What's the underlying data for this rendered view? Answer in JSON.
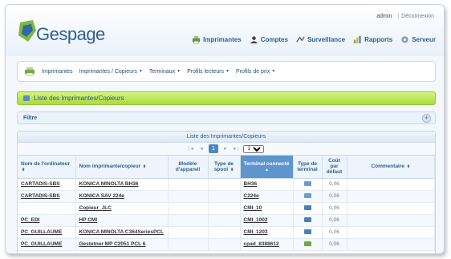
{
  "user": {
    "name": "admin",
    "logout": "Déconnexion"
  },
  "logo": {
    "text": "Gespage"
  },
  "topnav": [
    {
      "label": "Imprimantes",
      "icon": "printer-icon"
    },
    {
      "label": "Comptes",
      "icon": "user-icon"
    },
    {
      "label": "Surveillance",
      "icon": "monitor-icon"
    },
    {
      "label": "Rapports",
      "icon": "chart-icon"
    },
    {
      "label": "Serveur",
      "icon": "gear-icon"
    }
  ],
  "submenu": [
    {
      "label": "Imprimantes",
      "dropdown": false
    },
    {
      "label": "Imprimantes / Copieurs",
      "dropdown": true
    },
    {
      "label": "Terminaux",
      "dropdown": true
    },
    {
      "label": "Profils lecteurs",
      "dropdown": true
    },
    {
      "label": "Profils de prix",
      "dropdown": true
    }
  ],
  "page_title": "Liste des Imprimantes/Copieurs",
  "filter_label": "Filtre",
  "grid": {
    "caption": "Liste des Imprimantes/Copieurs",
    "pager": {
      "first": "|◄",
      "prev": "◄",
      "page": "1",
      "next": "►",
      "last": "►|",
      "page_size": "100"
    },
    "columns": [
      "Nom de l'ordinateur",
      "Nom imprimante/copieur",
      "Modèle d'appareil",
      "Type de spool",
      "Terminal connecté",
      "Type de terminal",
      "Coût par défaut",
      "Commentaire"
    ],
    "rows": [
      {
        "computer": "CARTADIS-SBS",
        "printer": "KONICA MINOLTA BH36",
        "model": "",
        "spool": "",
        "terminal": "BH36",
        "terminal_type": "terminal-icon",
        "cost": "0,06",
        "comment": ""
      },
      {
        "computer": "CARTADIS-SBS",
        "printer": "KONICA SAV 224e",
        "model": "",
        "spool": "",
        "terminal": "C224e",
        "terminal_type": "terminal-icon",
        "cost": "0,06",
        "comment": ""
      },
      {
        "computer": "",
        "printer": "Copieur_JLC",
        "model": "",
        "spool": "",
        "terminal": "CMI_10",
        "terminal_type": "card-reader-icon",
        "cost": "0,06",
        "comment": ""
      },
      {
        "computer": "PC_EDI",
        "printer": "HP CMI",
        "model": "",
        "spool": "",
        "terminal": "CMI_1002",
        "terminal_type": "card-reader-icon",
        "cost": "0,06",
        "comment": ""
      },
      {
        "computer": "PC_GUILLAUME",
        "printer": "KONICA MINOLTA C364SeriesPCL",
        "model": "",
        "spool": "",
        "terminal": "CMI_1203",
        "terminal_type": "card-reader-icon",
        "cost": "0,06",
        "comment": ""
      },
      {
        "computer": "PC_GUILLAUME",
        "printer": "Gestetner MP C2051 PCL 6",
        "model": "",
        "spool": "",
        "terminal": "cpad_8388612",
        "terminal_type": "terminal-green-icon",
        "cost": "0,06",
        "comment": ""
      }
    ]
  },
  "colors": {
    "accent": "#2b5e92",
    "sorted_header": "#5f95cf",
    "title_green": "#a9dc3b"
  }
}
